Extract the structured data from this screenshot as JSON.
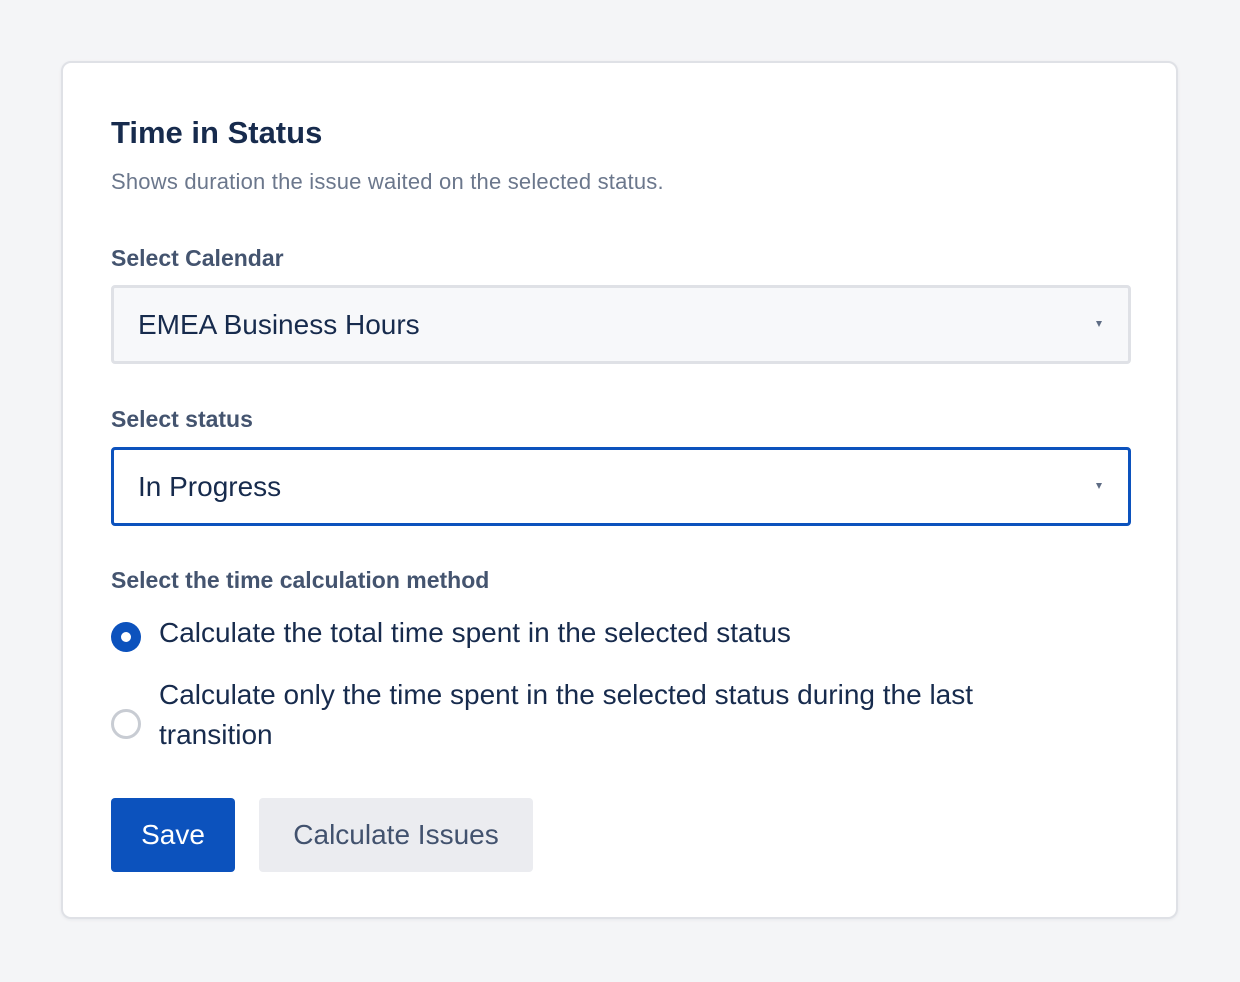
{
  "card": {
    "title": "Time in Status",
    "subtitle": "Shows duration the issue waited on the selected status."
  },
  "calendar_field": {
    "label": "Select Calendar",
    "value": "EMEA Business Hours",
    "state": "default"
  },
  "status_field": {
    "label": "Select status",
    "value": "In Progress",
    "state": "focused"
  },
  "method_field": {
    "label": "Select the time calculation method",
    "options": [
      {
        "label": "Calculate the total time spent in the selected status",
        "selected": true
      },
      {
        "label": "Calculate only the time spent in the selected status during the last transition",
        "selected": false
      }
    ]
  },
  "actions": {
    "save_label": "Save",
    "calculate_label": "Calculate Issues"
  },
  "icons": {
    "dropdown": "chevron-down-icon",
    "radio_selected": "radio-checked-icon",
    "radio_unselected": "radio-unchecked-icon"
  },
  "colors": {
    "page_background": "#f4f5f7",
    "card_background": "#ffffff",
    "primary": "#0c52bd",
    "heading": "#172b4d",
    "muted_text": "#6b778c",
    "field_label": "#44546f",
    "secondary_button": "#ebecf0",
    "border": "#dfe1e6"
  }
}
